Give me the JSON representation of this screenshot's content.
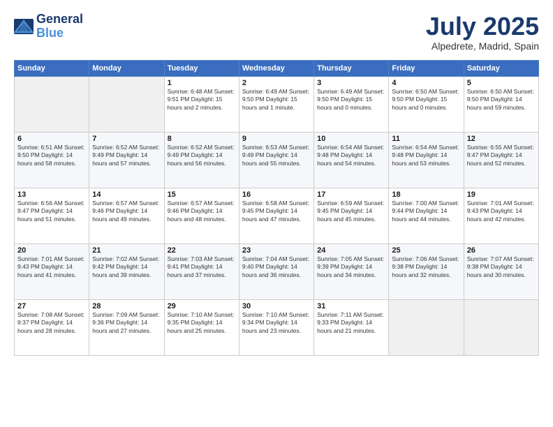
{
  "header": {
    "logo_line1": "General",
    "logo_line2": "Blue",
    "month_year": "July 2025",
    "location": "Alpedrete, Madrid, Spain"
  },
  "weekdays": [
    "Sunday",
    "Monday",
    "Tuesday",
    "Wednesday",
    "Thursday",
    "Friday",
    "Saturday"
  ],
  "weeks": [
    [
      {
        "day": "",
        "info": ""
      },
      {
        "day": "",
        "info": ""
      },
      {
        "day": "1",
        "info": "Sunrise: 6:48 AM\nSunset: 9:51 PM\nDaylight: 15 hours\nand 2 minutes."
      },
      {
        "day": "2",
        "info": "Sunrise: 6:49 AM\nSunset: 9:50 PM\nDaylight: 15 hours\nand 1 minute."
      },
      {
        "day": "3",
        "info": "Sunrise: 6:49 AM\nSunset: 9:50 PM\nDaylight: 15 hours\nand 0 minutes."
      },
      {
        "day": "4",
        "info": "Sunrise: 6:50 AM\nSunset: 9:50 PM\nDaylight: 15 hours\nand 0 minutes."
      },
      {
        "day": "5",
        "info": "Sunrise: 6:50 AM\nSunset: 9:50 PM\nDaylight: 14 hours\nand 59 minutes."
      }
    ],
    [
      {
        "day": "6",
        "info": "Sunrise: 6:51 AM\nSunset: 9:50 PM\nDaylight: 14 hours\nand 58 minutes."
      },
      {
        "day": "7",
        "info": "Sunrise: 6:52 AM\nSunset: 9:49 PM\nDaylight: 14 hours\nand 57 minutes."
      },
      {
        "day": "8",
        "info": "Sunrise: 6:52 AM\nSunset: 9:49 PM\nDaylight: 14 hours\nand 56 minutes."
      },
      {
        "day": "9",
        "info": "Sunrise: 6:53 AM\nSunset: 9:49 PM\nDaylight: 14 hours\nand 55 minutes."
      },
      {
        "day": "10",
        "info": "Sunrise: 6:54 AM\nSunset: 9:48 PM\nDaylight: 14 hours\nand 54 minutes."
      },
      {
        "day": "11",
        "info": "Sunrise: 6:54 AM\nSunset: 9:48 PM\nDaylight: 14 hours\nand 53 minutes."
      },
      {
        "day": "12",
        "info": "Sunrise: 6:55 AM\nSunset: 9:47 PM\nDaylight: 14 hours\nand 52 minutes."
      }
    ],
    [
      {
        "day": "13",
        "info": "Sunrise: 6:56 AM\nSunset: 9:47 PM\nDaylight: 14 hours\nand 51 minutes."
      },
      {
        "day": "14",
        "info": "Sunrise: 6:57 AM\nSunset: 9:46 PM\nDaylight: 14 hours\nand 49 minutes."
      },
      {
        "day": "15",
        "info": "Sunrise: 6:57 AM\nSunset: 9:46 PM\nDaylight: 14 hours\nand 48 minutes."
      },
      {
        "day": "16",
        "info": "Sunrise: 6:58 AM\nSunset: 9:45 PM\nDaylight: 14 hours\nand 47 minutes."
      },
      {
        "day": "17",
        "info": "Sunrise: 6:59 AM\nSunset: 9:45 PM\nDaylight: 14 hours\nand 45 minutes."
      },
      {
        "day": "18",
        "info": "Sunrise: 7:00 AM\nSunset: 9:44 PM\nDaylight: 14 hours\nand 44 minutes."
      },
      {
        "day": "19",
        "info": "Sunrise: 7:01 AM\nSunset: 9:43 PM\nDaylight: 14 hours\nand 42 minutes."
      }
    ],
    [
      {
        "day": "20",
        "info": "Sunrise: 7:01 AM\nSunset: 9:43 PM\nDaylight: 14 hours\nand 41 minutes."
      },
      {
        "day": "21",
        "info": "Sunrise: 7:02 AM\nSunset: 9:42 PM\nDaylight: 14 hours\nand 39 minutes."
      },
      {
        "day": "22",
        "info": "Sunrise: 7:03 AM\nSunset: 9:41 PM\nDaylight: 14 hours\nand 37 minutes."
      },
      {
        "day": "23",
        "info": "Sunrise: 7:04 AM\nSunset: 9:40 PM\nDaylight: 14 hours\nand 36 minutes."
      },
      {
        "day": "24",
        "info": "Sunrise: 7:05 AM\nSunset: 9:39 PM\nDaylight: 14 hours\nand 34 minutes."
      },
      {
        "day": "25",
        "info": "Sunrise: 7:06 AM\nSunset: 9:38 PM\nDaylight: 14 hours\nand 32 minutes."
      },
      {
        "day": "26",
        "info": "Sunrise: 7:07 AM\nSunset: 9:38 PM\nDaylight: 14 hours\nand 30 minutes."
      }
    ],
    [
      {
        "day": "27",
        "info": "Sunrise: 7:08 AM\nSunset: 9:37 PM\nDaylight: 14 hours\nand 28 minutes."
      },
      {
        "day": "28",
        "info": "Sunrise: 7:09 AM\nSunset: 9:36 PM\nDaylight: 14 hours\nand 27 minutes."
      },
      {
        "day": "29",
        "info": "Sunrise: 7:10 AM\nSunset: 9:35 PM\nDaylight: 14 hours\nand 25 minutes."
      },
      {
        "day": "30",
        "info": "Sunrise: 7:10 AM\nSunset: 9:34 PM\nDaylight: 14 hours\nand 23 minutes."
      },
      {
        "day": "31",
        "info": "Sunrise: 7:11 AM\nSunset: 9:33 PM\nDaylight: 14 hours\nand 21 minutes."
      },
      {
        "day": "",
        "info": ""
      },
      {
        "day": "",
        "info": ""
      }
    ]
  ]
}
